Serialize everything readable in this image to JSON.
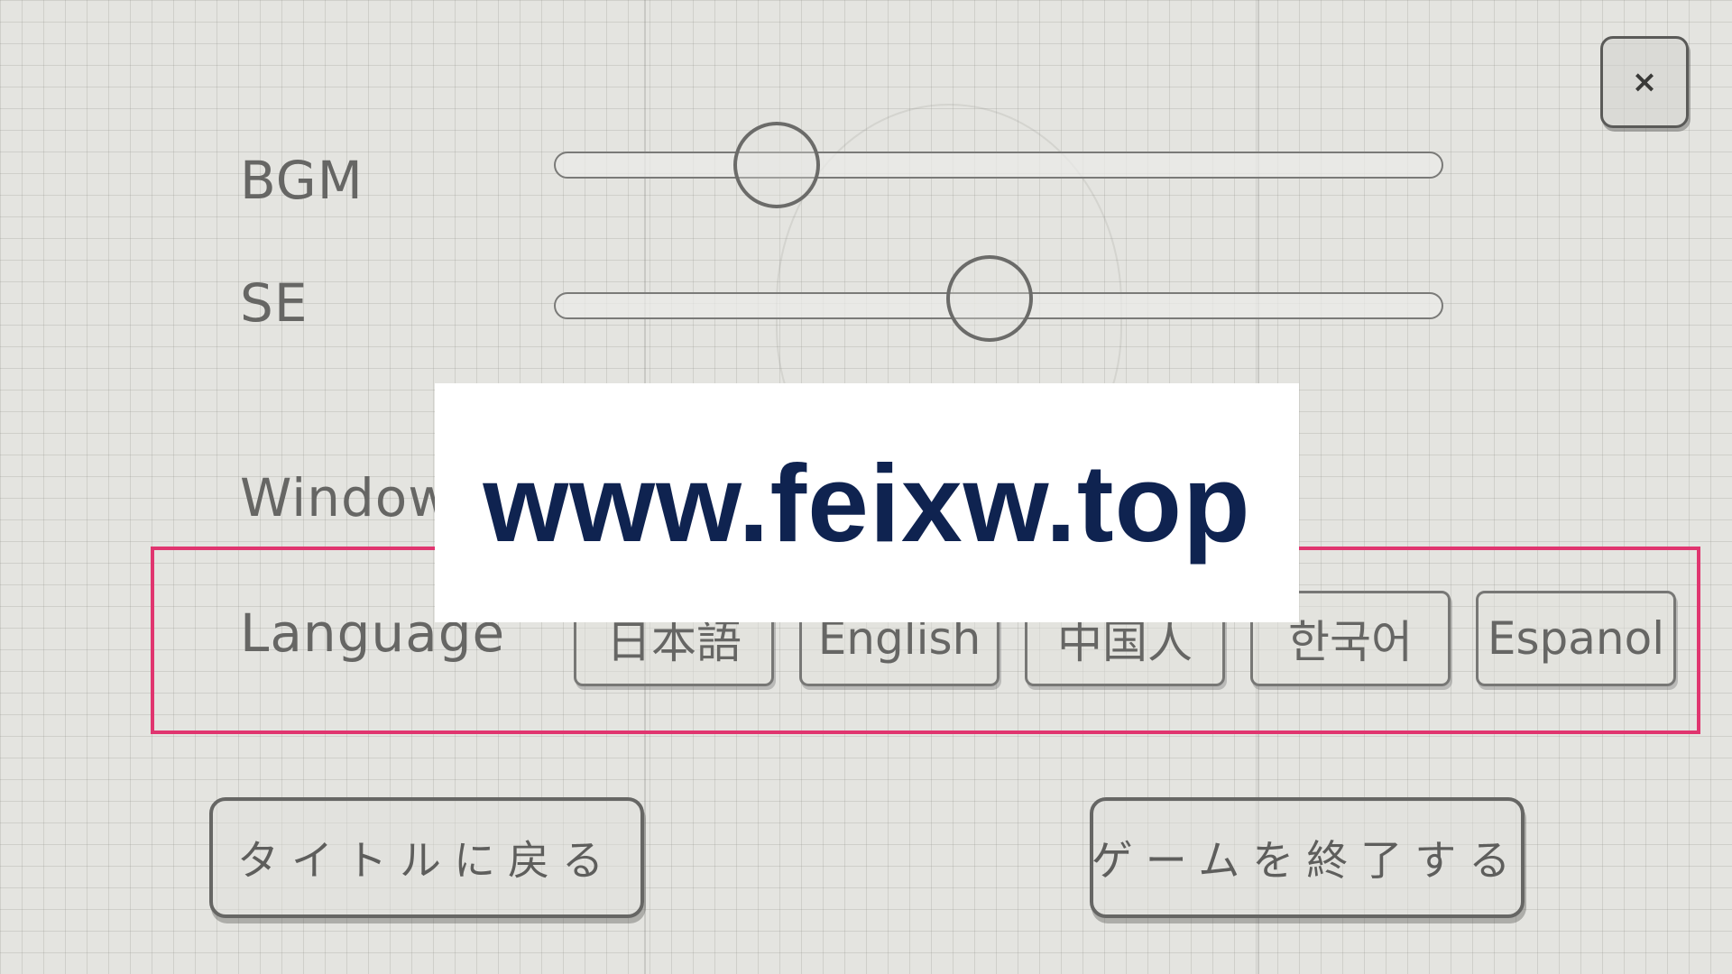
{
  "close_button": {
    "label": "×"
  },
  "settings": {
    "bgm": {
      "label": "BGM",
      "level": 0.25
    },
    "se": {
      "label": "SE",
      "level": 0.49
    },
    "window": {
      "label": "Window"
    }
  },
  "language": {
    "label": "Language",
    "options": [
      "日本語",
      "English",
      "中国人",
      "한국어",
      "Espanol"
    ]
  },
  "buttons": {
    "return_to_title": "タイトルに戻る",
    "quit_game": "ゲームを終了する"
  },
  "watermark": {
    "text": "www.feixw.top"
  },
  "colors": {
    "highlight": "#e0356f",
    "watermark_text": "#0f2350"
  }
}
